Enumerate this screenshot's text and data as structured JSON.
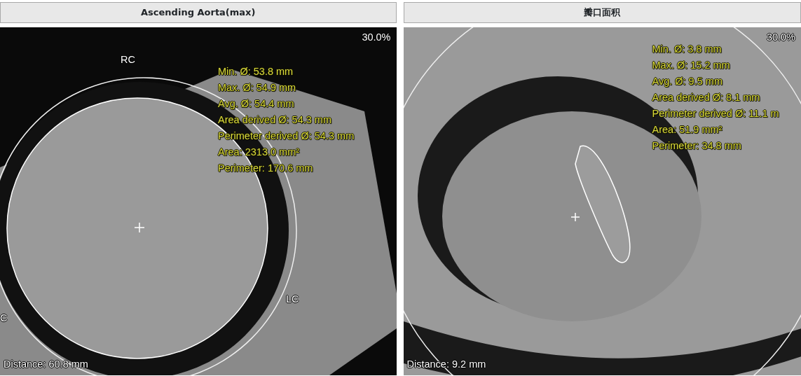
{
  "panels": [
    {
      "title": "Ascending Aorta(max)",
      "zoom": "30.0%",
      "labels": [
        {
          "text": "RC"
        },
        {
          "text": "LC"
        },
        {
          "text": "C"
        }
      ],
      "measurements": [
        "Min. Ø: 53.8 mm",
        "Max. Ø: 54.9 mm",
        "Avg. Ø: 54.4 mm",
        "Area derived Ø: 54.3 mm",
        "Perimeter derived Ø: 54.3 mm",
        "Area: 2313.0 mm²",
        "Perimeter: 170.6 mm"
      ],
      "distance": "Distance: 60.8 mm"
    },
    {
      "title": "瓣口面积",
      "zoom": "30.0%",
      "measurements": [
        "Min. Ø: 3.8 mm",
        "Max. Ø: 15.2 mm",
        "Avg. Ø: 9.5 mm",
        "Area derived Ø: 8.1 mm",
        "Perimeter derived Ø: 11.1 m",
        "Area: 51.9 mm²",
        "Perimeter: 34.8 mm"
      ],
      "distance": "Distance: 9.2 mm"
    }
  ]
}
